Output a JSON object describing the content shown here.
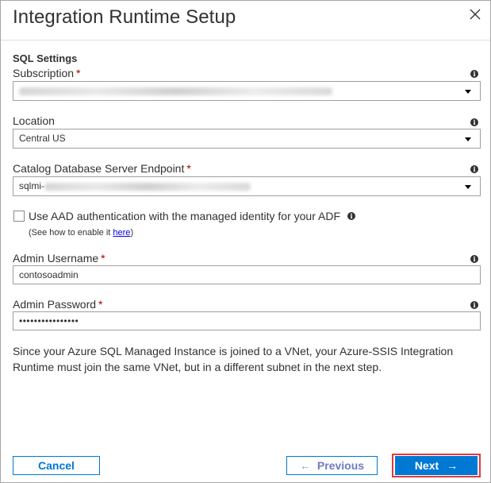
{
  "dialog": {
    "title": "Integration Runtime Setup",
    "close_icon": "close-icon"
  },
  "sql_settings": {
    "section_title": "SQL Settings",
    "subscription": {
      "label": "Subscription",
      "required": "*",
      "value_prefix": ""
    },
    "location": {
      "label": "Location",
      "value": "Central US"
    },
    "catalog_endpoint": {
      "label": "Catalog Database Server Endpoint",
      "required": "*",
      "value_prefix": "sqlmi-"
    },
    "aad": {
      "label": "Use AAD authentication with the managed identity for your ADF",
      "checked": false,
      "hint_prefix": "(See how to enable it ",
      "hint_link": "here",
      "hint_suffix": ")"
    },
    "admin_username": {
      "label": "Admin Username",
      "required": "*",
      "value": "contosoadmin"
    },
    "admin_password": {
      "label": "Admin Password",
      "required": "*",
      "value": "••••••••••••••••"
    },
    "info_icon": "info-icon",
    "note": "Since your Azure SQL Managed Instance is joined to a VNet, your Azure-SSIS Integration Runtime must join the same VNet, but in a different subnet in the next step."
  },
  "footer": {
    "cancel_label": "Cancel",
    "previous_label": "Previous",
    "previous_arrow": "←",
    "next_label": "Next",
    "next_arrow": "→"
  },
  "colors": {
    "accent": "#0078d4",
    "required": "#a80000",
    "highlight": "#e0393e"
  }
}
